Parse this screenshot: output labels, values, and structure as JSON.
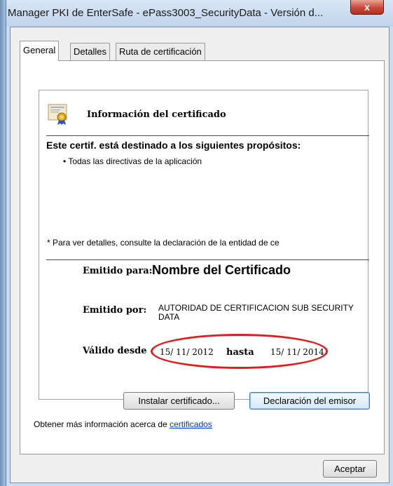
{
  "window": {
    "title": "Manager PKI de EnterSafe  - ePass3003_SecurityData - Versión d...",
    "close_label": "x"
  },
  "tabs": [
    {
      "label": "General"
    },
    {
      "label": "Detalles"
    },
    {
      "label": "Ruta de certificación"
    }
  ],
  "certificate": {
    "icon": "certificate-icon",
    "heading": "Información del certificado",
    "purpose_heading": "Este certif. está destinado a los siguientes propósitos:",
    "purpose_item": "• Todas las directivas de la aplicación",
    "note": "* Para ver detalles, consulte la declaración de la entidad de ce",
    "issued_to_label": "Emitido para:",
    "issued_to_value": "Nombre del Certificado",
    "issued_by_label": "Emitido por:",
    "issued_by_value": "AUTORIDAD DE CERTIFICACION SUB SECURITY DATA",
    "valid_from_label": "Válido desde",
    "valid_from_value": "15/ 11/ 2012",
    "valid_to_label": "hasta",
    "valid_to_value": "15/ 11/ 2014"
  },
  "buttons": {
    "install": "Instalar certificado...",
    "issuer_statement": "Declaración del emisor",
    "ok": "Aceptar"
  },
  "more_info": {
    "text": "Obtener más información acerca de ",
    "link": "certificados"
  },
  "colors": {
    "highlight": "#e01c1c",
    "link": "#0033cc"
  }
}
